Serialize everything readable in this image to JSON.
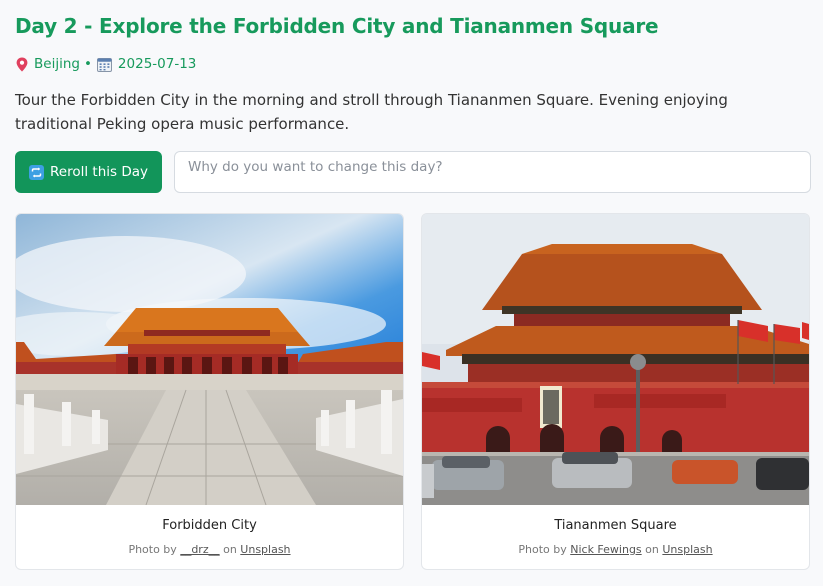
{
  "day": {
    "title": "Day 2 - Explore the Forbidden City and Tiananmen Square",
    "location": "Beijing",
    "separator": "•",
    "date": "2025-07-13",
    "description": "Tour the Forbidden City in the morning and stroll through Tiananmen Square. Evening enjoying traditional Peking opera music performance."
  },
  "reroll": {
    "button_label": "Reroll this Day",
    "input_value": "",
    "input_placeholder": "Why do you want to change this day?"
  },
  "cards": [
    {
      "caption": "Forbidden City",
      "credit_prefix": "Photo by",
      "photographer": "__drz__",
      "credit_mid": "on",
      "source": "Unsplash"
    },
    {
      "caption": "Tiananmen Square",
      "credit_prefix": "Photo by",
      "photographer": "Nick Fewings",
      "credit_mid": "on",
      "source": "Unsplash"
    }
  ],
  "icons": {
    "location": "map-pin-icon",
    "date": "calendar-icon",
    "reroll": "repeat-icon"
  },
  "colors": {
    "accent": "#179a5c",
    "button": "#12955a",
    "page_background": "#f8f9fb"
  }
}
